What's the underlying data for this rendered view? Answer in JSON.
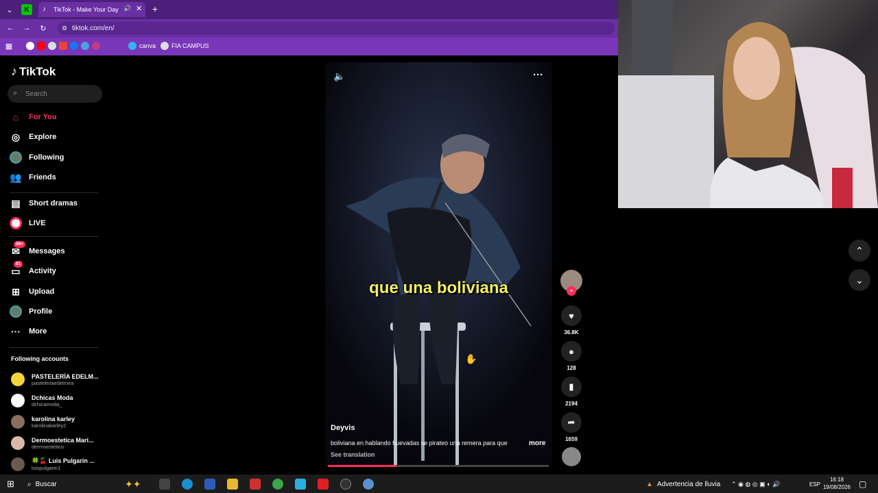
{
  "browser": {
    "tab_title": "TikTok - Make Your Day",
    "url": "tiktok.com/en/",
    "bookmarks": [
      "canva",
      "FIA CAMPUS"
    ]
  },
  "sidebar": {
    "logo": "TikTok",
    "search_placeholder": "Search",
    "nav": [
      {
        "label": "For You",
        "icon": "home-icon",
        "active": true
      },
      {
        "label": "Explore",
        "icon": "compass-icon"
      },
      {
        "label": "Following",
        "icon": "following-avatar-icon"
      },
      {
        "label": "Friends",
        "icon": "friends-icon"
      },
      {
        "label": "Short dramas",
        "icon": "film-icon"
      },
      {
        "label": "LIVE",
        "icon": "live-icon"
      },
      {
        "label": "Messages",
        "icon": "message-icon",
        "badge": "99+"
      },
      {
        "label": "Activity",
        "icon": "inbox-icon",
        "badge": "81"
      },
      {
        "label": "Upload",
        "icon": "plus-square-icon"
      },
      {
        "label": "Profile",
        "icon": "profile-avatar-icon"
      },
      {
        "label": "More",
        "icon": "dots-icon"
      }
    ],
    "following_title": "Following accounts",
    "accounts": [
      {
        "name": "PASTELERÍA EDELM...",
        "handle": "pasteleriaedelmira",
        "color": "#f0d43a"
      },
      {
        "name": "Dchicas Moda",
        "handle": "dchicamoda_",
        "color": "#ffffff"
      },
      {
        "name": "karolina karley",
        "handle": "karolinakarley2",
        "color": "#8a6e60"
      },
      {
        "name": "Dermoestetica Mari...",
        "handle": "dermoestetico",
        "color": "#d9b8a8"
      },
      {
        "name": "🍀🍒 Luis Pulgarin ...",
        "handle": "luispulgarin1",
        "color": "#6a5a50"
      }
    ]
  },
  "video": {
    "caption": "que una boliviana",
    "author": "Deyvis",
    "description": "boliviana en hablando huevadas se pirateo una remera para que",
    "more_label": "more",
    "see_translation": "See translation",
    "progress": 0.31
  },
  "actions": {
    "likes": "36.8K",
    "comments": "128",
    "saves": "2194",
    "shares": "1659"
  },
  "taskbar": {
    "search_label": "Buscar",
    "weather": "Advertencia de lluvia",
    "lang": "ESP",
    "time": "16:18",
    "date": "19/08/2026"
  },
  "colors": {
    "accent": "#fe2c55",
    "tabbar": "#4b1f7a",
    "caption": "#f4f060"
  }
}
